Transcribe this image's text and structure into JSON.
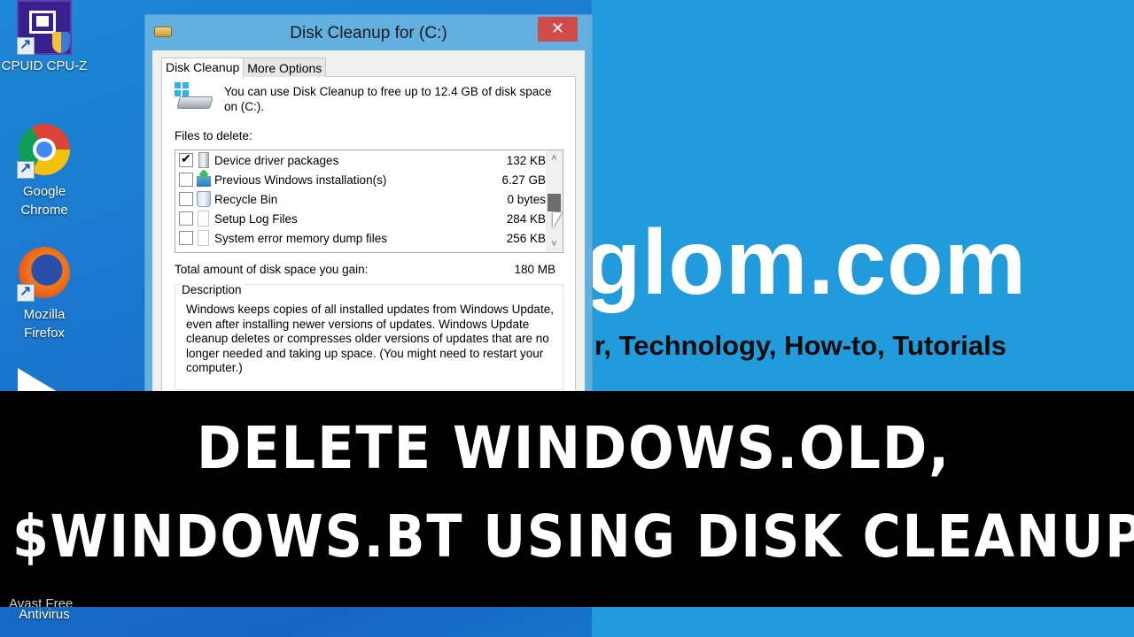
{
  "desktop": {
    "icons": [
      {
        "label": "CPUID CPU-Z",
        "icon": "cpu-z-icon"
      },
      {
        "label": "Google Chrome",
        "icon": "chrome-icon"
      },
      {
        "label": "Mozilla Firefox",
        "icon": "firefox-icon"
      },
      {
        "label": "",
        "icon": "media-player-icon"
      }
    ],
    "avast_label": "Antivirus",
    "avast_label_partial": "Avast Free"
  },
  "dialog": {
    "title": "Disk Cleanup for  (C:)",
    "close_glyph": "✕",
    "tabs": [
      {
        "label": "Disk Cleanup",
        "active": true
      },
      {
        "label": "More Options",
        "active": false
      }
    ],
    "intro": "You can use Disk Cleanup to free up to 12.4 GB of disk space on  (C:).",
    "files_label": "Files to delete:",
    "files": [
      {
        "name": "Device driver packages",
        "size": "132 KB",
        "checked": true,
        "icon": "driver-package-icon"
      },
      {
        "name": "Previous Windows installation(s)",
        "size": "6.27 GB",
        "checked": false,
        "icon": "previous-windows-icon"
      },
      {
        "name": "Recycle Bin",
        "size": "0 bytes",
        "checked": false,
        "icon": "recycle-bin-icon"
      },
      {
        "name": "Setup Log Files",
        "size": "284 KB",
        "checked": false,
        "icon": "document-icon"
      },
      {
        "name": "System error memory dump files",
        "size": "256 KB",
        "checked": false,
        "icon": "document-icon"
      }
    ],
    "scroll_up": "˄",
    "scroll_down": "˅",
    "total_label": "Total amount of disk space you gain:",
    "total_value": "180 MB",
    "description_label": "Description",
    "description": "Windows keeps copies of all installed updates from Windows Update, even after installing newer versions of updates. Windows Update cleanup deletes or compresses older versions of updates that are no longer needed and taking up space. (You might need to restart your computer.)"
  },
  "branding": {
    "site": "glom.com",
    "tagline": "r, Technology, How-to, Tutorials"
  },
  "banner": {
    "line1": "DELETE WINDOWS.OLD,",
    "line2": "$WINDOWS.BT USING DISK CLEANUP"
  }
}
